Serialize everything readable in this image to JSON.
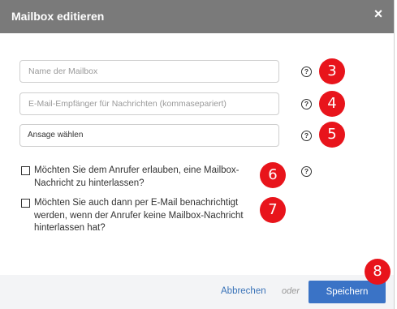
{
  "dialog": {
    "title": "Mailbox editieren",
    "close_symbol": "×"
  },
  "fields": {
    "name_placeholder": "Name der Mailbox",
    "email_placeholder": "E-Mail-Empfänger für Nachrichten (kommasepariert)",
    "announcement_label": "Ansage wählen"
  },
  "help_symbol": "?",
  "checkboxes": {
    "allow_no_message_line1": "Möchten Sie dem Anrufer erlauben, eine Mailbox-",
    "allow_no_message_line2": "Nachricht zu hinterlassen?",
    "notify_no_message_line1": "Möchten Sie auch dann per E-Mail benachrichtigt",
    "notify_no_message_line2": "werden, wenn der Anrufer keine Mailbox-Nachricht",
    "notify_no_message_line3": "hinterlassen hat?"
  },
  "badges": {
    "b3": "3",
    "b4": "4",
    "b5": "5",
    "b6": "6",
    "b7": "7",
    "b8": "8"
  },
  "footer": {
    "cancel_label": "Abbrechen",
    "or_label": "oder",
    "save_label": "Speichern"
  },
  "colors": {
    "header": "#7a7a7a",
    "badge": "#e8141b",
    "link": "#3a73b8",
    "save_button": "#3a73c6"
  }
}
